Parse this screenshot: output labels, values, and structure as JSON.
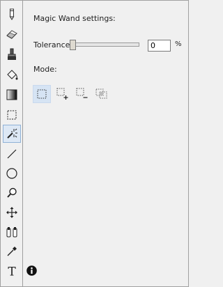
{
  "panel": {
    "title": "Magic Wand settings:",
    "tolerance_label": "Tolerance:",
    "tolerance_value": "0",
    "tolerance_unit": "%",
    "tolerance_slider_percent": 0,
    "mode_label": "Mode:",
    "selected_mode": "replace-selection"
  },
  "toolbar": {
    "tools": [
      "pencil",
      "eraser",
      "brush",
      "paint-bucket",
      "gradient",
      "rectangle-select",
      "magic-wand",
      "line",
      "ellipse",
      "zoom",
      "pan",
      "color-swap",
      "color-picker",
      "text"
    ],
    "active_tool": "magic-wand"
  },
  "mode_buttons": [
    "replace-selection",
    "add-to-selection",
    "subtract-from-selection",
    "intersect-selection"
  ],
  "colors": {
    "background": "#f0f0f0",
    "active_highlight": "#dde8f5",
    "active_border": "#8fb1d6"
  }
}
